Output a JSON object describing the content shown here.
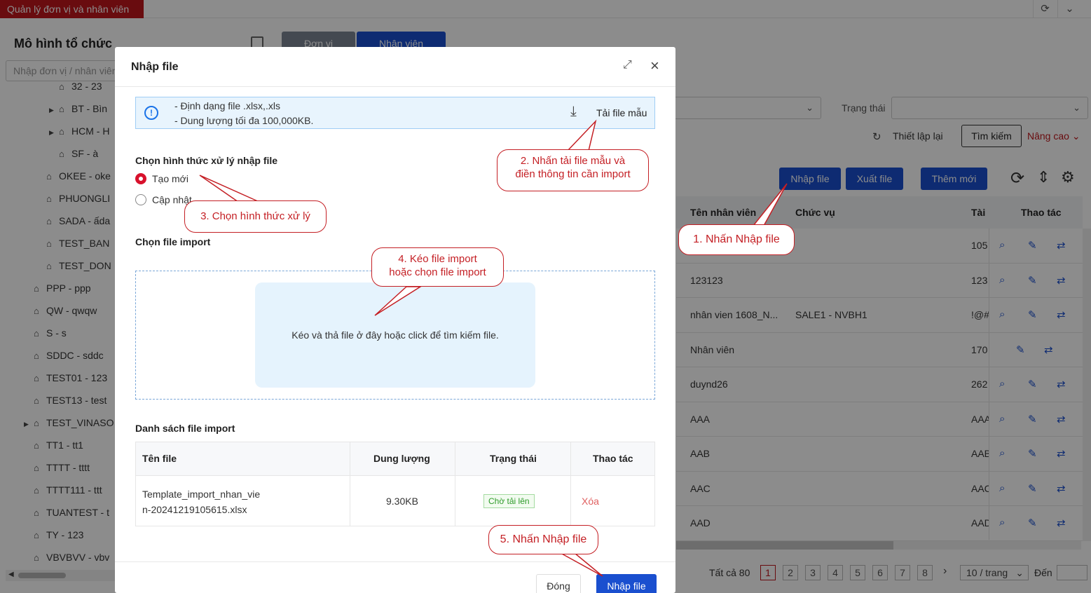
{
  "app_tab": "Quản lý đơn vị và nhân viên",
  "left_panel": {
    "title": "Mô hình tổ chức",
    "search_placeholder": "Nhập đơn vị / nhân viên",
    "tree": [
      {
        "label": "32 - 23",
        "level": 3,
        "caret": false
      },
      {
        "label": "BT - Bìn",
        "level": 3,
        "caret": true
      },
      {
        "label": "HCM - H",
        "level": 3,
        "caret": true
      },
      {
        "label": "SF - à",
        "level": 3,
        "caret": false
      },
      {
        "label": "OKEE - oke",
        "level": 2,
        "caret": false
      },
      {
        "label": "PHUONGLI",
        "level": 2,
        "caret": false
      },
      {
        "label": "SADA - ấda",
        "level": 2,
        "caret": false
      },
      {
        "label": "TEST_BAN",
        "level": 2,
        "caret": false
      },
      {
        "label": "TEST_DON",
        "level": 2,
        "caret": false
      },
      {
        "label": "PPP - ppp",
        "level": 1,
        "caret": false
      },
      {
        "label": "QW - qwqw",
        "level": 1,
        "caret": false
      },
      {
        "label": "S - s",
        "level": 1,
        "caret": false
      },
      {
        "label": "SDDC - sddc",
        "level": 1,
        "caret": false
      },
      {
        "label": "TEST01 - 123",
        "level": 1,
        "caret": false
      },
      {
        "label": "TEST13 - test",
        "level": 1,
        "caret": false
      },
      {
        "label": "TEST_VINASO",
        "level": 1,
        "caret": true
      },
      {
        "label": "TT1 - tt1",
        "level": 1,
        "caret": false
      },
      {
        "label": "TTTT - tttt",
        "level": 1,
        "caret": false
      },
      {
        "label": "TTTT111 - ttt",
        "level": 1,
        "caret": false
      },
      {
        "label": "TUANTEST - t",
        "level": 1,
        "caret": false
      },
      {
        "label": "TY - 123",
        "level": 1,
        "caret": false
      },
      {
        "label": "VBVBVV - vbv",
        "level": 1,
        "caret": false
      }
    ]
  },
  "tabs": {
    "unit": "Đơn vị",
    "staff": "Nhân viên"
  },
  "filters": {
    "status_label": "Trạng thái",
    "reset": "Thiết lập lại",
    "search": "Tìm kiếm",
    "advanced": "Nâng cao"
  },
  "toolbar": {
    "import": "Nhập file",
    "export": "Xuất file",
    "add": "Thêm mới"
  },
  "table": {
    "headers": {
      "name": "Tên nhân viên",
      "position": "Chức vụ",
      "account": "Tài kh",
      "actions": "Thao tác"
    },
    "rows": [
      {
        "name": "",
        "position": "",
        "account": "105"
      },
      {
        "name": "123123",
        "position": "",
        "account": "123"
      },
      {
        "name": "nhân vien 1608_N...",
        "position": "SALE1 - NVBH1",
        "account": "!@#"
      },
      {
        "name": "Nhân viên",
        "position": "",
        "account": "170"
      },
      {
        "name": "duynd26",
        "position": "",
        "account": "262"
      },
      {
        "name": "AAA",
        "position": "",
        "account": "AAA"
      },
      {
        "name": "AAB",
        "position": "",
        "account": "AAB"
      },
      {
        "name": "AAC",
        "position": "",
        "account": "AAC"
      },
      {
        "name": "AAD",
        "position": "",
        "account": "AAD"
      }
    ]
  },
  "pagination": {
    "total": "Tất cả 80",
    "pages": [
      "1",
      "2",
      "3",
      "4",
      "5",
      "6",
      "7",
      "8"
    ],
    "per_page": "10 / trang",
    "goto": "Đến"
  },
  "modal": {
    "title": "Nhập file",
    "info_line1": "- Định dạng file .xlsx,.xls",
    "info_line2": "- Dung lượng tối đa 100,000KB.",
    "download_template": "Tải file mẫu",
    "process_title": "Chọn hình thức xử lý nhập file",
    "option_new": "Tạo mới",
    "option_update": "Cập nhật",
    "choose_file_title": "Chọn file import",
    "drop_text": "Kéo và thả file ở đây hoặc click để tìm kiếm file.",
    "file_list_title": "Danh sách file import",
    "file_headers": {
      "name": "Tên file",
      "size": "Dung lượng",
      "status": "Trạng thái",
      "action": "Thao tác"
    },
    "file": {
      "name_line1": "Template_import_nhan_vie",
      "name_line2": "n-20241219105615.xlsx",
      "size": "9.30KB",
      "status": "Chờ tải lên",
      "action": "Xóa"
    },
    "close_btn": "Đóng",
    "submit_btn": "Nhập file"
  },
  "callouts": {
    "step1": "1. Nhấn Nhập file",
    "step2_line1": "2. Nhấn tải file mẫu và",
    "step2_line2": "điền thông tin cần import",
    "step3": "3. Chọn hình thức xử lý",
    "step4_line1": "4. Kéo file import",
    "step4_line2": "hoặc chọn file import",
    "step5": "5. Nhấn Nhập file"
  },
  "colors": {
    "brand_red": "#c0161c",
    "primary": "#1a4fcf",
    "callout": "#c41f24"
  }
}
